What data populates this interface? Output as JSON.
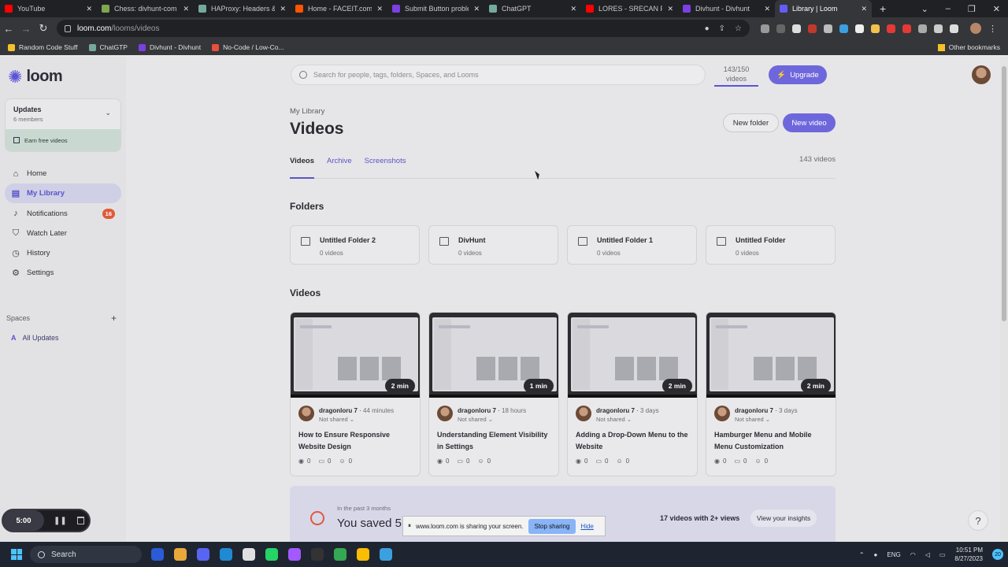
{
  "browser": {
    "tabs": [
      {
        "label": "YouTube",
        "color": "#ff0000"
      },
      {
        "label": "Chess: divhunt-com vs",
        "color": "#7fa650"
      },
      {
        "label": "HAProxy: Headers & C",
        "color": "#74aa9c"
      },
      {
        "label": "Home - FACEIT.com",
        "color": "#ff5500"
      },
      {
        "label": "Submit Button proble",
        "color": "#7b3fe4"
      },
      {
        "label": "ChatGPT",
        "color": "#74aa9c"
      },
      {
        "label": "LORES - SRECAN PUT",
        "color": "#ff0000"
      },
      {
        "label": "Divhunt - Divhunt",
        "color": "#7b3fe4"
      },
      {
        "label": "Library | Loom",
        "color": "#625df5",
        "active": true
      }
    ],
    "url_host": "loom.com",
    "url_path": "/looms/videos",
    "bookmarks": [
      {
        "label": "Random Code Stuff",
        "color": "#f6c02b"
      },
      {
        "label": "ChatGTP",
        "color": "#74aa9c"
      },
      {
        "label": "Divhunt - Divhunt",
        "color": "#7b3fe4"
      },
      {
        "label": "No-Code / Low-Co...",
        "color": "#e94f3a"
      }
    ],
    "other_bookmarks": "Other bookmarks"
  },
  "sidebar": {
    "brand": "loom",
    "workspace": {
      "name": "Updates",
      "members": "6 members",
      "earn": "Earn free videos"
    },
    "nav": [
      {
        "label": "Home",
        "icon": "home-icon",
        "glyph": "⌂"
      },
      {
        "label": "My Library",
        "icon": "library-icon",
        "glyph": "▤",
        "active": true
      },
      {
        "label": "Notifications",
        "icon": "bell-icon",
        "glyph": "♪",
        "badge": "16"
      },
      {
        "label": "Watch Later",
        "icon": "bookmark-icon",
        "glyph": "⛉"
      },
      {
        "label": "History",
        "icon": "clock-icon",
        "glyph": "◷"
      },
      {
        "label": "Settings",
        "icon": "gear-icon",
        "glyph": "⚙"
      }
    ],
    "spaces_label": "Spaces",
    "space_item": {
      "letter": "A",
      "label": "All Updates"
    }
  },
  "header": {
    "search_placeholder": "Search for people, tags, folders, Spaces, and Looms",
    "quota_line1": "143/150",
    "quota_line2": "videos",
    "upgrade": "Upgrade"
  },
  "page": {
    "breadcrumb": "My Library",
    "title": "Videos",
    "new_folder": "New folder",
    "new_video": "New video",
    "tabs": [
      "Videos",
      "Archive",
      "Screenshots"
    ],
    "video_count": "143 videos",
    "folders_heading": "Folders",
    "videos_heading": "Videos"
  },
  "folders": [
    {
      "name": "Untitled Folder 2",
      "count": "0 videos"
    },
    {
      "name": "DivHunt",
      "count": "0 videos"
    },
    {
      "name": "Untitled Folder 1",
      "count": "0 videos"
    },
    {
      "name": "Untitled Folder",
      "count": "0 videos"
    }
  ],
  "videos": [
    {
      "duration": "2 min",
      "owner": "dragonloru 7",
      "ago": "44 minutes",
      "shared": "Not shared",
      "title": "How to Ensure Responsive Website Design",
      "views": "0",
      "comments": "0",
      "reactions": "0"
    },
    {
      "duration": "1 min",
      "owner": "dragonloru 7",
      "ago": "18 hours",
      "shared": "Not shared",
      "title": "Understanding Element Visibility in Settings",
      "views": "0",
      "comments": "0",
      "reactions": "0"
    },
    {
      "duration": "2 min",
      "owner": "dragonloru 7",
      "ago": "3 days",
      "shared": "Not shared",
      "title": "Adding a Drop-Down Menu to the Website",
      "views": "0",
      "comments": "0",
      "reactions": "0"
    },
    {
      "duration": "2 min",
      "owner": "dragonloru 7",
      "ago": "3 days",
      "shared": "Not shared",
      "title": "Hamburger Menu and Mobile Menu Customization",
      "views": "0",
      "comments": "0",
      "reactions": "0"
    }
  ],
  "insights": {
    "subtitle": "In the past 3 months",
    "headline": "You saved 5",
    "right_text": "17 videos with 2+ views",
    "button": "View your insights"
  },
  "recorder": {
    "timer": "5:00"
  },
  "sharebar": {
    "message": "www.loom.com is sharing your screen.",
    "stop": "Stop sharing",
    "hide": "Hide"
  },
  "taskbar": {
    "search": "Search",
    "lang": "ENG",
    "time": "10:51 PM",
    "date": "8/27/2023",
    "notif_count": "20"
  }
}
